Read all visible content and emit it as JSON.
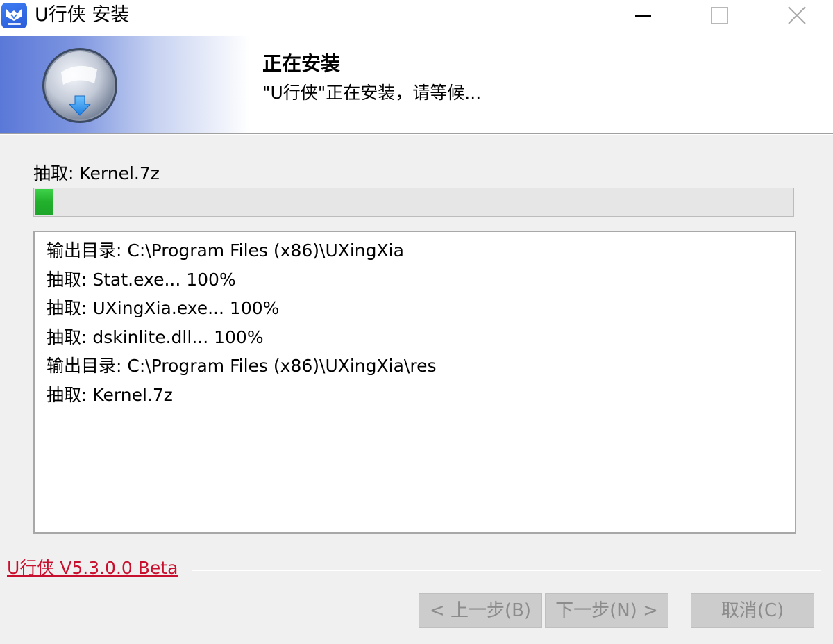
{
  "window": {
    "title": "U行侠 安装"
  },
  "header": {
    "title": "正在安装",
    "subtitle": "\"U行侠\"正在安装，请等候..."
  },
  "status": {
    "current": "抽取: Kernel.7z"
  },
  "progress": {
    "percent": 2.5,
    "fill_color": "#2bbd36"
  },
  "log": {
    "lines": [
      "输出目录: C:\\Program Files (x86)\\UXingXia",
      "抽取: Stat.exe... 100%",
      "抽取: UXingXia.exe... 100%",
      "抽取: dskinlite.dll... 100%",
      "输出目录: C:\\Program Files (x86)\\UXingXia\\res",
      "抽取: Kernel.7z"
    ]
  },
  "footer": {
    "brand": "U行侠 V5.3.0.0  Beta",
    "brand_color": "#c8102e",
    "back_label": "< 上一步(B)",
    "next_label": "下一步(N) >",
    "cancel_label": "取消(C)"
  },
  "icons": {
    "app": "app-logo-icon",
    "installer": "installer-disc-icon",
    "minimize": "minimize-icon",
    "maximize": "maximize-icon",
    "close": "close-icon"
  }
}
